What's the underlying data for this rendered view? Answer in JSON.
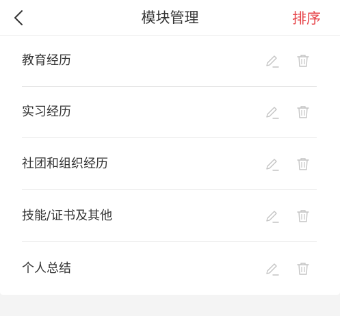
{
  "header": {
    "back_icon": "chevron-left-icon",
    "title": "模块管理",
    "sort_label": "排序",
    "accent_color": "#e6454a"
  },
  "modules": [
    {
      "label": "教育经历",
      "edit_icon": "pencil-icon",
      "delete_icon": "trash-icon"
    },
    {
      "label": "实习经历",
      "edit_icon": "pencil-icon",
      "delete_icon": "trash-icon"
    },
    {
      "label": "社团和组织经历",
      "edit_icon": "pencil-icon",
      "delete_icon": "trash-icon"
    },
    {
      "label": "技能/证书及其他",
      "edit_icon": "pencil-icon",
      "delete_icon": "trash-icon"
    },
    {
      "label": "个人总结",
      "edit_icon": "pencil-icon",
      "delete_icon": "trash-icon"
    }
  ]
}
